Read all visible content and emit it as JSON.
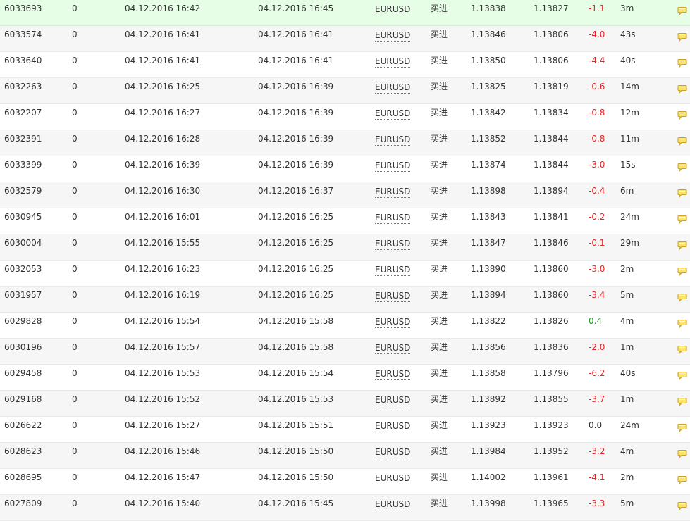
{
  "colors": {
    "negative": "#e02626",
    "positive": "#1a9a1a",
    "neutral": "#333333",
    "highlight_row": "#e6fde6",
    "alt_row": "#f6f6f6"
  },
  "note_icon": "speech-bubble-icon",
  "rows": [
    {
      "ticket": "6033693",
      "flag": "0",
      "open_time": "04.12.2016 16:42",
      "close_time": "04.12.2016 16:45",
      "symbol": "EURUSD",
      "type": "买进",
      "open_price": "1.13838",
      "close_price": "1.13827",
      "profit": "-1.1",
      "duration": "3m"
    },
    {
      "ticket": "6033574",
      "flag": "0",
      "open_time": "04.12.2016 16:41",
      "close_time": "04.12.2016 16:41",
      "symbol": "EURUSD",
      "type": "买进",
      "open_price": "1.13846",
      "close_price": "1.13806",
      "profit": "-4.0",
      "duration": "43s"
    },
    {
      "ticket": "6033640",
      "flag": "0",
      "open_time": "04.12.2016 16:41",
      "close_time": "04.12.2016 16:41",
      "symbol": "EURUSD",
      "type": "买进",
      "open_price": "1.13850",
      "close_price": "1.13806",
      "profit": "-4.4",
      "duration": "40s"
    },
    {
      "ticket": "6032263",
      "flag": "0",
      "open_time": "04.12.2016 16:25",
      "close_time": "04.12.2016 16:39",
      "symbol": "EURUSD",
      "type": "买进",
      "open_price": "1.13825",
      "close_price": "1.13819",
      "profit": "-0.6",
      "duration": "14m"
    },
    {
      "ticket": "6032207",
      "flag": "0",
      "open_time": "04.12.2016 16:27",
      "close_time": "04.12.2016 16:39",
      "symbol": "EURUSD",
      "type": "买进",
      "open_price": "1.13842",
      "close_price": "1.13834",
      "profit": "-0.8",
      "duration": "12m"
    },
    {
      "ticket": "6032391",
      "flag": "0",
      "open_time": "04.12.2016 16:28",
      "close_time": "04.12.2016 16:39",
      "symbol": "EURUSD",
      "type": "买进",
      "open_price": "1.13852",
      "close_price": "1.13844",
      "profit": "-0.8",
      "duration": "11m"
    },
    {
      "ticket": "6033399",
      "flag": "0",
      "open_time": "04.12.2016 16:39",
      "close_time": "04.12.2016 16:39",
      "symbol": "EURUSD",
      "type": "买进",
      "open_price": "1.13874",
      "close_price": "1.13844",
      "profit": "-3.0",
      "duration": "15s"
    },
    {
      "ticket": "6032579",
      "flag": "0",
      "open_time": "04.12.2016 16:30",
      "close_time": "04.12.2016 16:37",
      "symbol": "EURUSD",
      "type": "买进",
      "open_price": "1.13898",
      "close_price": "1.13894",
      "profit": "-0.4",
      "duration": "6m"
    },
    {
      "ticket": "6030945",
      "flag": "0",
      "open_time": "04.12.2016 16:01",
      "close_time": "04.12.2016 16:25",
      "symbol": "EURUSD",
      "type": "买进",
      "open_price": "1.13843",
      "close_price": "1.13841",
      "profit": "-0.2",
      "duration": "24m"
    },
    {
      "ticket": "6030004",
      "flag": "0",
      "open_time": "04.12.2016 15:55",
      "close_time": "04.12.2016 16:25",
      "symbol": "EURUSD",
      "type": "买进",
      "open_price": "1.13847",
      "close_price": "1.13846",
      "profit": "-0.1",
      "duration": "29m"
    },
    {
      "ticket": "6032053",
      "flag": "0",
      "open_time": "04.12.2016 16:23",
      "close_time": "04.12.2016 16:25",
      "symbol": "EURUSD",
      "type": "买进",
      "open_price": "1.13890",
      "close_price": "1.13860",
      "profit": "-3.0",
      "duration": "2m"
    },
    {
      "ticket": "6031957",
      "flag": "0",
      "open_time": "04.12.2016 16:19",
      "close_time": "04.12.2016 16:25",
      "symbol": "EURUSD",
      "type": "买进",
      "open_price": "1.13894",
      "close_price": "1.13860",
      "profit": "-3.4",
      "duration": "5m"
    },
    {
      "ticket": "6029828",
      "flag": "0",
      "open_time": "04.12.2016 15:54",
      "close_time": "04.12.2016 15:58",
      "symbol": "EURUSD",
      "type": "买进",
      "open_price": "1.13822",
      "close_price": "1.13826",
      "profit": "0.4",
      "duration": "4m"
    },
    {
      "ticket": "6030196",
      "flag": "0",
      "open_time": "04.12.2016 15:57",
      "close_time": "04.12.2016 15:58",
      "symbol": "EURUSD",
      "type": "买进",
      "open_price": "1.13856",
      "close_price": "1.13836",
      "profit": "-2.0",
      "duration": "1m"
    },
    {
      "ticket": "6029458",
      "flag": "0",
      "open_time": "04.12.2016 15:53",
      "close_time": "04.12.2016 15:54",
      "symbol": "EURUSD",
      "type": "买进",
      "open_price": "1.13858",
      "close_price": "1.13796",
      "profit": "-6.2",
      "duration": "40s"
    },
    {
      "ticket": "6029168",
      "flag": "0",
      "open_time": "04.12.2016 15:52",
      "close_time": "04.12.2016 15:53",
      "symbol": "EURUSD",
      "type": "买进",
      "open_price": "1.13892",
      "close_price": "1.13855",
      "profit": "-3.7",
      "duration": "1m"
    },
    {
      "ticket": "6026622",
      "flag": "0",
      "open_time": "04.12.2016 15:27",
      "close_time": "04.12.2016 15:51",
      "symbol": "EURUSD",
      "type": "买进",
      "open_price": "1.13923",
      "close_price": "1.13923",
      "profit": "0.0",
      "duration": "24m"
    },
    {
      "ticket": "6028623",
      "flag": "0",
      "open_time": "04.12.2016 15:46",
      "close_time": "04.12.2016 15:50",
      "symbol": "EURUSD",
      "type": "买进",
      "open_price": "1.13984",
      "close_price": "1.13952",
      "profit": "-3.2",
      "duration": "4m"
    },
    {
      "ticket": "6028695",
      "flag": "0",
      "open_time": "04.12.2016 15:47",
      "close_time": "04.12.2016 15:50",
      "symbol": "EURUSD",
      "type": "买进",
      "open_price": "1.14002",
      "close_price": "1.13961",
      "profit": "-4.1",
      "duration": "2m"
    },
    {
      "ticket": "6027809",
      "flag": "0",
      "open_time": "04.12.2016 15:40",
      "close_time": "04.12.2016 15:45",
      "symbol": "EURUSD",
      "type": "买进",
      "open_price": "1.13998",
      "close_price": "1.13965",
      "profit": "-3.3",
      "duration": "5m"
    }
  ]
}
